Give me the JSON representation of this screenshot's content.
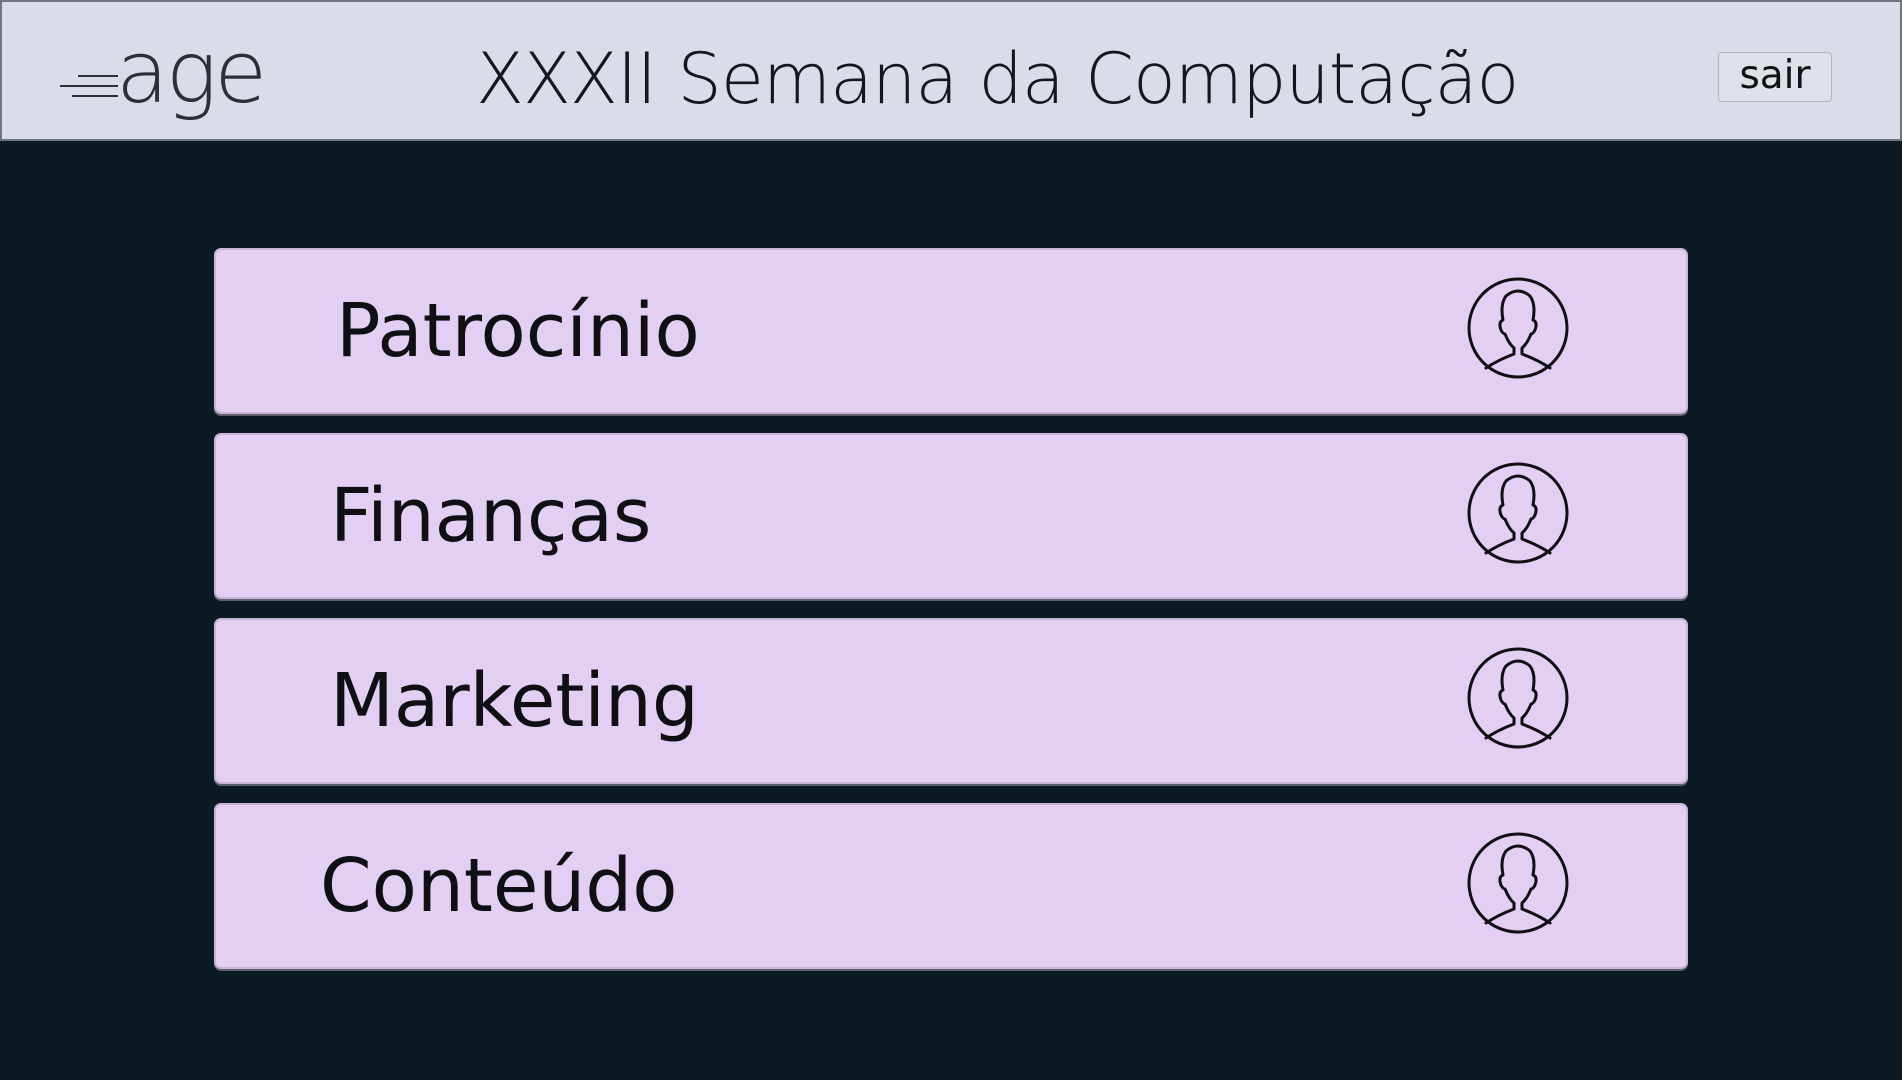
{
  "header": {
    "logo_text": "age",
    "title": "XXXII Semana da Computação",
    "logout_label": "sair"
  },
  "menu": {
    "items": [
      {
        "label": "Patrocínio",
        "icon": "user-avatar-icon"
      },
      {
        "label": "Finanças",
        "icon": "user-avatar-icon"
      },
      {
        "label": "Marketing",
        "icon": "user-avatar-icon"
      },
      {
        "label": "Conteúdo",
        "icon": "user-avatar-icon"
      }
    ]
  },
  "colors": {
    "header_bg": "#d8dde7",
    "page_bg": "#0c1a24",
    "item_bg": "#e3cef4"
  }
}
